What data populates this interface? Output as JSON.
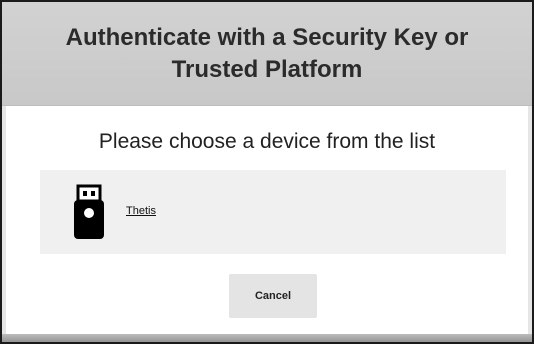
{
  "dialog": {
    "title": "Authenticate with a Security Key or Trusted Platform",
    "prompt": "Please choose a device from the list"
  },
  "devices": [
    {
      "name": "Thetis",
      "icon": "usb-key-icon"
    }
  ],
  "buttons": {
    "cancel_label": "Cancel"
  },
  "colors": {
    "header_bg": "#c8c8c8",
    "device_row_bg": "#f0f0f0",
    "button_bg": "#e4e4e4",
    "text": "#222222"
  }
}
